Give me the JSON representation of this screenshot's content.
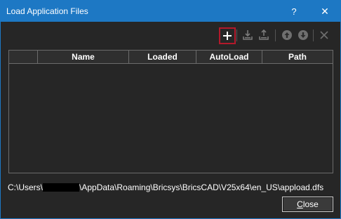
{
  "window": {
    "title": "Load Application Files",
    "help_label": "?",
    "close_glyph": "✕"
  },
  "toolbar": {
    "add_icon": "plus-icon",
    "import_icon": "import-icon",
    "export_icon": "export-icon",
    "up_icon": "move-up-icon",
    "down_icon": "move-down-icon",
    "remove_icon": "remove-icon",
    "add_highlight_color": "#b3192b"
  },
  "grid": {
    "columns": [
      "",
      "Name",
      "Loaded",
      "AutoLoad",
      "Path"
    ],
    "rows": []
  },
  "footer": {
    "path_prefix": "C:\\Users\\",
    "path_suffix": "\\AppData\\Roaming\\Bricsys\\BricsCAD\\V25x64\\en_US\\appload.dfs",
    "close_label_first": "C",
    "close_label_rest": "lose"
  },
  "colors": {
    "titlebar": "#1d78c4",
    "background": "#262626"
  }
}
